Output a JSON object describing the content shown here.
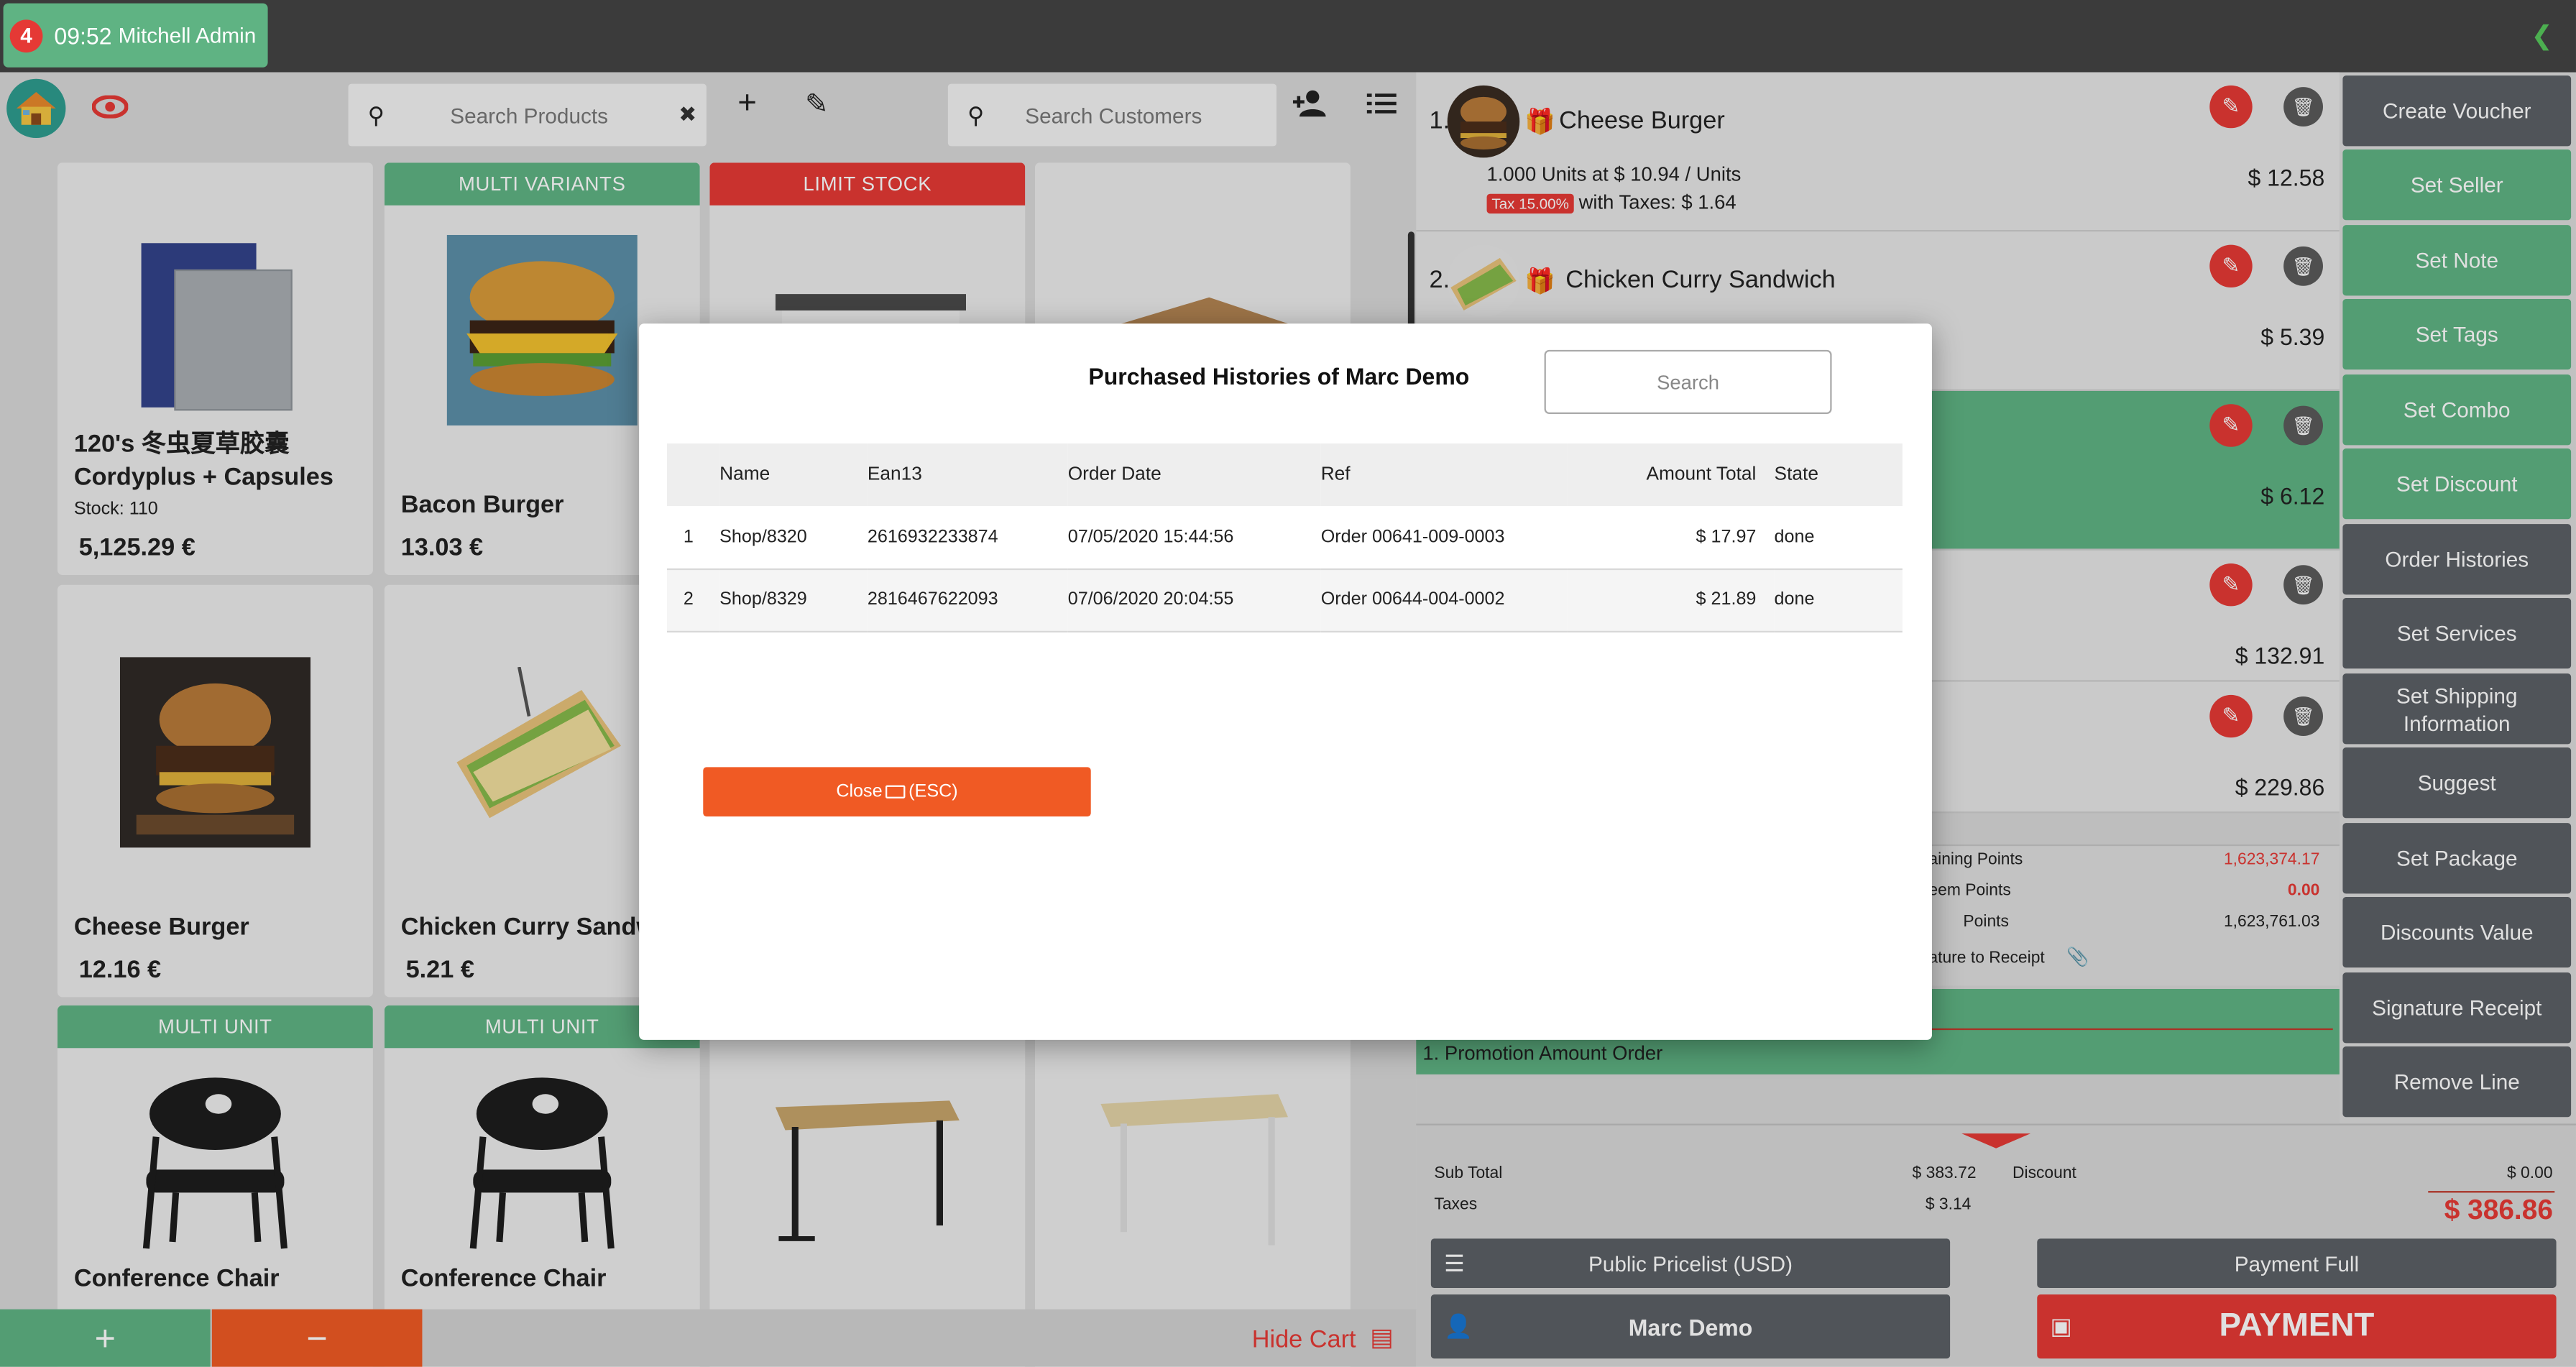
{
  "topbar": {
    "badge": "4",
    "time": "09:52",
    "user": "Mitchell Admin"
  },
  "toolbar": {
    "search_products_placeholder": "Search Products",
    "search_customers_placeholder": "Search Customers"
  },
  "products": [
    {
      "name_line1": "120's 冬虫夏草胶囊",
      "name_line2": "Cordyplus + Capsules",
      "stock": "Stock: 110",
      "price": "5,125.29 €",
      "tag": ""
    },
    {
      "name_line1": "Bacon Burger",
      "price": "13.03 €",
      "tag": "MULTI VARIANTS"
    },
    {
      "name_line1": "",
      "price": "",
      "tag": "LIMIT STOCK"
    },
    {
      "name_line1": "",
      "price": "",
      "tag": ""
    },
    {
      "name_line1": "Cheese Burger",
      "price": "12.16 €",
      "tag": ""
    },
    {
      "name_line1": "Chicken Curry Sandwich",
      "price": "5.21 €",
      "tag": ""
    },
    {
      "name_line1": "Conference Chair",
      "price": "",
      "tag": "MULTI UNIT"
    },
    {
      "name_line1": "Conference Chair",
      "price": "",
      "tag": "MULTI UNIT"
    },
    {
      "name_line1": "",
      "price": "",
      "tag": ""
    },
    {
      "name_line1": "",
      "price": "",
      "tag": ""
    }
  ],
  "bottombar": {
    "plus": "+",
    "minus": "−",
    "hide_cart": "Hide Cart"
  },
  "order": {
    "lines": [
      {
        "num": "1.",
        "name": "Cheese Burger",
        "detail": "1.000 Units at $ 10.94 / Units",
        "tax_badge": "Tax 15.00%",
        "with_taxes": "with Taxes: $ 1.64",
        "total": "$ 12.58"
      },
      {
        "num": "2.",
        "name": "Chicken Curry Sandwich",
        "total": "$ 5.39"
      },
      {
        "total": "$ 6.12"
      },
      {
        "total": "$ 132.91"
      },
      {
        "total": "$ 229.86"
      }
    ],
    "points": [
      {
        "label": "aining Points",
        "value": "1,623,374.17"
      },
      {
        "label": "eem Points",
        "value": "0.00"
      },
      {
        "label": "Points",
        "value": "1,623,761.03"
      },
      {
        "label": "ature to Receipt",
        "value": ""
      }
    ],
    "promotion": "1. Promotion Amount Order"
  },
  "actions": [
    "Create Voucher",
    "Set Seller",
    "Set Note",
    "Set Tags",
    "Set Combo",
    "Set Discount",
    "Order Histories",
    "Set Services",
    "Set Shipping Information",
    "Suggest",
    "Set Package",
    "Discounts Value",
    "Signature Receipt",
    "Remove Line"
  ],
  "footer": {
    "sub_total_label": "Sub Total",
    "sub_total": "$ 383.72",
    "taxes_label": "Taxes",
    "taxes": "$ 3.14",
    "discount_label": "Discount",
    "discount": "$ 0.00",
    "grand_total": "$ 386.86",
    "pricelist": "Public Pricelist (USD)",
    "payment_full": "Payment Full",
    "customer": "Marc Demo",
    "payment": "PAYMENT"
  },
  "modal": {
    "title": "Purchased Histories of Marc Demo",
    "search_placeholder": "Search",
    "columns": [
      "",
      "Name",
      "Ean13",
      "Order Date",
      "Ref",
      "Amount Total",
      "State"
    ],
    "rows": [
      [
        "1",
        "Shop/8320",
        "2616932233874",
        "07/05/2020 15:44:56",
        "Order 00641-009-0003",
        "$ 17.97",
        "done"
      ],
      [
        "2",
        "Shop/8329",
        "2816467622093",
        "07/06/2020 20:04:55",
        "Order 00644-004-0002",
        "$ 21.89",
        "done"
      ]
    ],
    "close_label": "Close",
    "close_hint": "(ESC)"
  },
  "colors": {
    "green": "#5fb383",
    "red": "#e53935",
    "orange": "#f05a24",
    "dark": "#5c6066"
  }
}
